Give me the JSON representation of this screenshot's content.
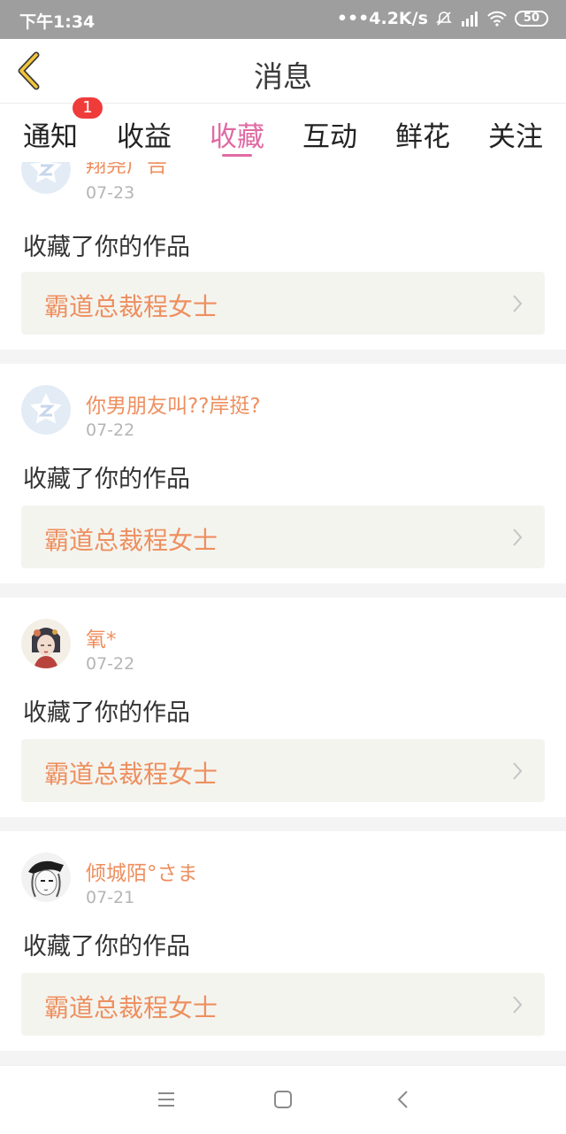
{
  "status": {
    "time": "下午1:34",
    "network": "•••4.2K/s",
    "battery": "50"
  },
  "header": {
    "title": "消息"
  },
  "tabs": [
    {
      "label": "通知",
      "active": false,
      "badge": "1"
    },
    {
      "label": "收益",
      "active": false
    },
    {
      "label": "收藏",
      "active": true
    },
    {
      "label": "互动",
      "active": false
    },
    {
      "label": "鲜花",
      "active": false
    },
    {
      "label": "关注",
      "active": false
    }
  ],
  "items": [
    {
      "user": "翔尧广告",
      "date": "07-23",
      "action": "收藏了你的作品",
      "work": "霸道总裁程女士",
      "avatar": "default-avatar-icon"
    },
    {
      "user": "你男朋友叫??岸挺?",
      "date": "07-22",
      "action": "收藏了你的作品",
      "work": "霸道总裁程女士",
      "avatar": "default-avatar-icon"
    },
    {
      "user": "氧*",
      "date": "07-22",
      "action": "收藏了你的作品",
      "work": "霸道总裁程女士",
      "avatar": "portrait-avatar"
    },
    {
      "user": "倾城陌°さま",
      "date": "07-21",
      "action": "收藏了你的作品",
      "work": "霸道总裁程女士",
      "avatar": "sketch-avatar"
    }
  ],
  "colors": {
    "accent": "#e06aa3",
    "username": "#ee8f5f",
    "badge": "#f03b3b",
    "statusbar": "#9e9e9e"
  }
}
